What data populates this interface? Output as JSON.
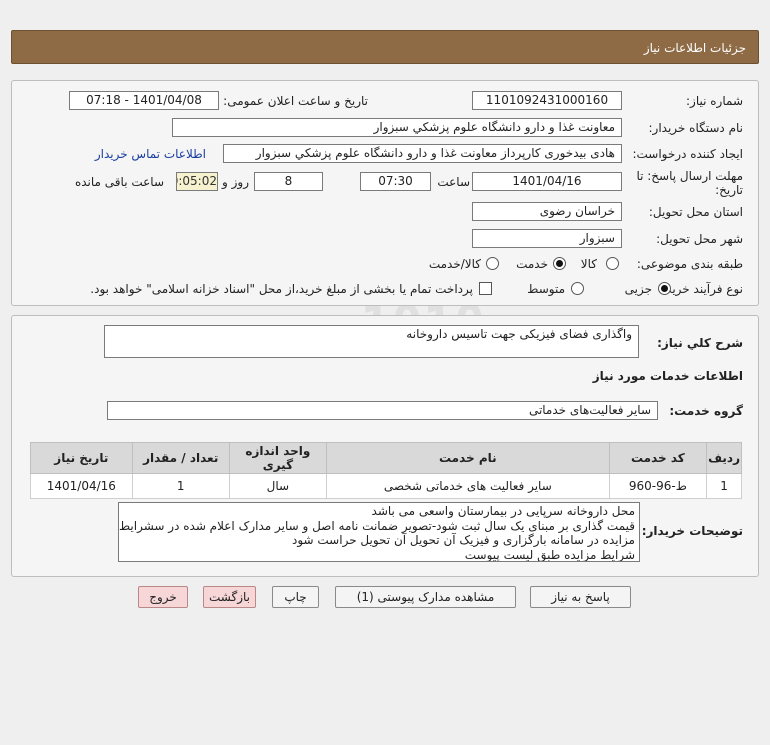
{
  "header": {
    "title": "جزئیات اطلاعات نیاز"
  },
  "form": {
    "need_number_label": "شماره نیاز:",
    "need_number": "1101092431000160",
    "announce_label": "تاریخ و ساعت اعلان عمومی:",
    "announce_value": "1401/04/08 - 07:18",
    "buyer_org_label": "نام دستگاه خریدار:",
    "buyer_org": "معاونت غذا و دارو   دانشگاه علوم پزشکي سبزوار",
    "requester_label": "ایجاد کننده درخواست:",
    "requester": "هادی بیدخوری کارپرداز معاونت غذا و دارو   دانشگاه علوم پزشکي سبزوار",
    "contact_link": "اطلاعات تماس خریدار",
    "deadline_label": "مهلت ارسال پاسخ: تا تاریخ:",
    "deadline_date": "1401/04/16",
    "time_label": "ساعت",
    "deadline_time": "07:30",
    "days_value": "8",
    "days_label": "روز و",
    "remaining_value": "00:05:02",
    "remaining_label": "ساعت باقی مانده",
    "province_label": "استان محل تحویل:",
    "province": "خراسان رضوی",
    "city_label": "شهر محل تحویل:",
    "city": "سبزوار",
    "category_label": "طبقه بندی موضوعی:",
    "category_options": [
      "کالا",
      "خدمت",
      "کالا/خدمت"
    ],
    "category_selected": 1,
    "process_label": "نوع فرآیند خرید :",
    "process_options": [
      "جزیی",
      "متوسط"
    ],
    "process_selected": 0,
    "treasury_note": "پرداخت تمام یا بخشی از مبلغ خرید،از محل \"اسناد خزانه اسلامی\" خواهد بود."
  },
  "details": {
    "summary_label": "شرح کلي نیاز:",
    "summary": "واگذاری فضای فیزیکی جهت تاسیس داروخانه",
    "services_heading": "اطلاعات خدمات مورد نیاز",
    "service_group_label": "گروه خدمت:",
    "service_group": "سایر فعالیت‌های خدماتی",
    "table": {
      "headers": [
        "ردیف",
        "کد خدمت",
        "نام خدمت",
        "واحد اندازه گیری",
        "تعداد / مقدار",
        "تاریخ نیاز"
      ],
      "rows": [
        [
          "1",
          "ط-96-960",
          "سایر فعالیت های خدماتی شخصی",
          "سال",
          "1",
          "1401/04/16"
        ]
      ]
    },
    "buyer_notes_label": "توضیحات خریدار:",
    "buyer_notes": [
      "محل داروخانه سرپایی در بیمارستان واسعی می باشد",
      "قیمت گذاری بر مبنای یک سال ثبت شود-تصویر ضمانت نامه اصل و سایر مدارک اعلام شده در سشرایط",
      "مزایده در سامانه بارگزاری و فیزیک آن تحویل آن تحویل حراست شود",
      "شرایط مزایده طبق لیست پیوست"
    ]
  },
  "buttons": {
    "reply": "پاسخ به نیاز",
    "attachments": "مشاهده مدارک پیوستی (1)",
    "print": "چاپ",
    "back": "بازگشت",
    "exit": "خروج"
  },
  "watermark": {
    "brand": "ParsNamadData",
    "bits": [
      "010101",
      "0001",
      "1010"
    ]
  },
  "colors": {
    "titlebar": "#8e6b45",
    "link": "#1a3ea0",
    "pink_button": "#f6d6d6"
  }
}
